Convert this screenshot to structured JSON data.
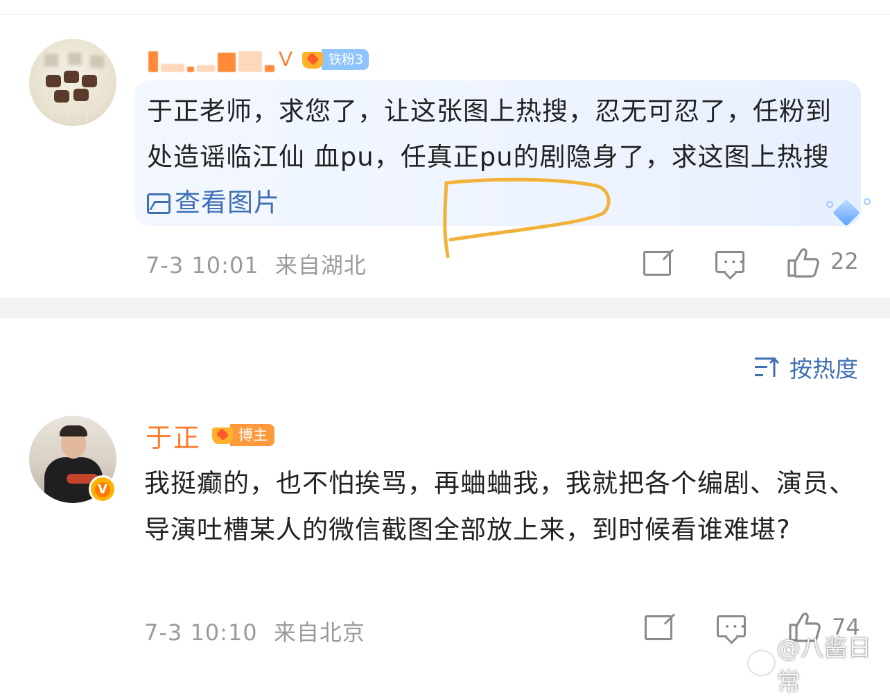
{
  "comment1": {
    "name": "",
    "fan_badge": "铁粉3",
    "text": "于正老师，求您了，让这张图上热搜，忍无可忍了，任粉到处造谣临江仙 血pu，任真正pu的剧隐身了，求这图上热搜 ",
    "view_image_label": "查看图片",
    "time": "7-3 10:01",
    "location": "来自湖北",
    "likes": "22"
  },
  "sort": {
    "label": "按热度"
  },
  "comment2": {
    "name": "于正",
    "role_badge": "博主",
    "text": "我挺癫的，也不怕挨骂，再蛐蛐我，我就把各个编剧、演员、导演吐槽某人的微信截图全部放上来，到时候看谁难堪?",
    "time": "7-3 10:10",
    "location": "来自北京",
    "likes": "74"
  },
  "watermark": {
    "text": "@八酱日常"
  },
  "colors": {
    "accent_link": "#3e6fb4",
    "name_orange": "#ff7b2b",
    "meta_gray": "#9a9a9a",
    "highlight": "#f2b23a"
  }
}
